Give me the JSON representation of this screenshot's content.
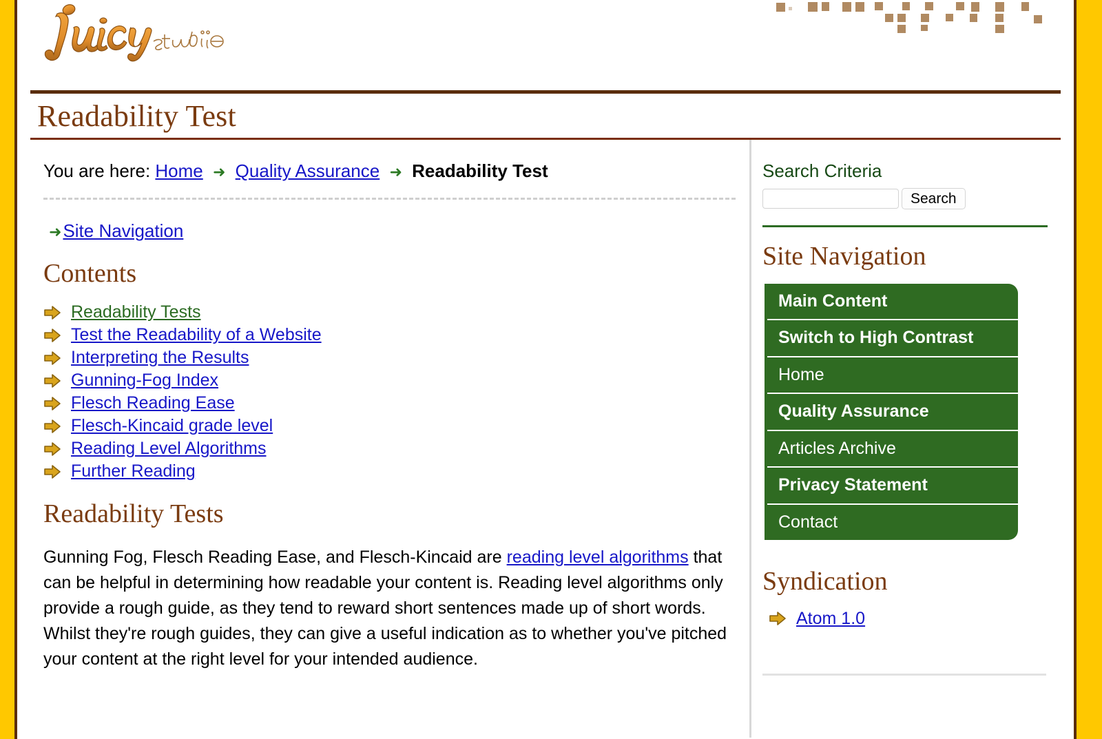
{
  "site": {
    "logo_text": "juicy",
    "logo_text_2": "studio",
    "logo_alt": "Juicy Studio"
  },
  "header": {
    "page_title": "Readability Test"
  },
  "breadcrumb": {
    "prefix": "You are here:",
    "items": [
      {
        "label": "Home",
        "type": "link"
      },
      {
        "label": "Quality Assurance",
        "type": "link"
      },
      {
        "label": "Readability Test",
        "type": "current"
      }
    ],
    "separator": "➜"
  },
  "skip": {
    "arrow": "➜",
    "label": "Site Navigation"
  },
  "contents": {
    "heading": "Contents",
    "items": [
      {
        "label": "Readability Tests",
        "visited": true
      },
      {
        "label": "Test the Readability of a Website",
        "visited": false
      },
      {
        "label": "Interpreting the Results",
        "visited": false
      },
      {
        "label": "Gunning-Fog Index",
        "visited": false
      },
      {
        "label": "Flesch Reading Ease",
        "visited": false
      },
      {
        "label": "Flesch-Kincaid grade level",
        "visited": false
      },
      {
        "label": "Reading Level Algorithms",
        "visited": false
      },
      {
        "label": "Further Reading",
        "visited": false
      }
    ]
  },
  "article": {
    "heading": "Readability Tests",
    "paragraph_part1": "Gunning Fog, Flesch Reading Ease, and Flesch-Kincaid are ",
    "paragraph_link": "reading level algorithms",
    "paragraph_part2": " that can be helpful in determining how readable your content is. Reading level algorithms only provide a rough guide, as they tend to reward short sentences made up of short words. Whilst they're rough guides, they can give a useful indication as to whether you've pitched your content at the right level for your intended audience."
  },
  "sidebar": {
    "search": {
      "heading": "Search Criteria",
      "value": "",
      "placeholder": "",
      "button_label": "Search"
    },
    "navigation": {
      "heading": "Site Navigation",
      "items": [
        {
          "label": "Main Content"
        },
        {
          "label": "Switch to High Contrast"
        },
        {
          "label": "Home"
        },
        {
          "label": "Quality Assurance"
        },
        {
          "label": "Articles Archive"
        },
        {
          "label": "Privacy Statement"
        },
        {
          "label": "Contact"
        }
      ]
    },
    "syndication": {
      "heading": "Syndication",
      "items": [
        {
          "label": "Atom 1.0"
        }
      ]
    }
  },
  "colors": {
    "frame_yellow": "#ffc800",
    "frame_brown": "#5a2d0c",
    "heading_brown": "#7a3b10",
    "nav_green": "#2f6b22",
    "link_blue": "#1717c8",
    "visited_green": "#2b6b22",
    "bullet_gold": "#d9a41c",
    "search_heading_green": "#184a16",
    "deco_tan": "#b08a62"
  }
}
